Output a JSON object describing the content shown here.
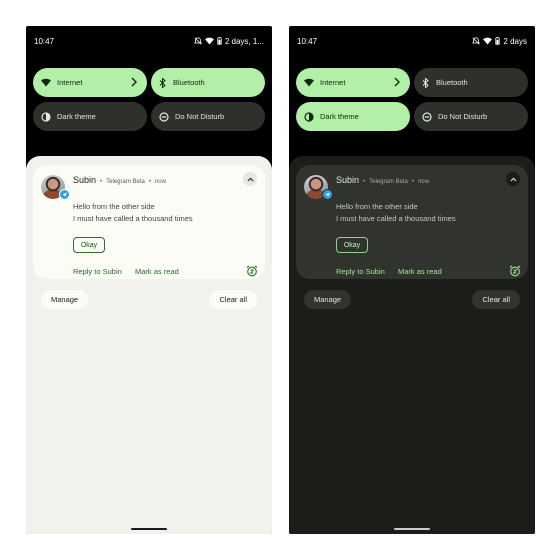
{
  "status": {
    "time": "10:47",
    "left_battery": "2 days, 1...",
    "right_battery": "2 days"
  },
  "tiles": {
    "internet": "Internet",
    "bluetooth": "Bluetooth",
    "dark_theme": "Dark theme",
    "dnd": "Do Not Disturb"
  },
  "notification": {
    "sender": "Subin",
    "app": "Telegram Beta",
    "time": "now",
    "separator": "•",
    "line1": "Hello from the other side",
    "line2": "I must have called a thousand times",
    "quick_reply": "Okay",
    "reply_action": "Reply to Subin",
    "mark_read_action": "Mark as read"
  },
  "footer": {
    "manage": "Manage",
    "clear_all": "Clear all"
  },
  "colors": {
    "tile_on": "#b1f0a6",
    "tile_off": "#2e302c",
    "accent_light": "#2b6a2a",
    "accent_dark": "#a6e49a"
  },
  "icons": [
    "wifi-icon",
    "bluetooth-icon",
    "dark-theme-icon",
    "do-not-disturb-icon",
    "chevron-right-icon",
    "chevron-up-icon",
    "snooze-icon",
    "telegram-badge-icon",
    "mute-icon",
    "battery-icon"
  ]
}
